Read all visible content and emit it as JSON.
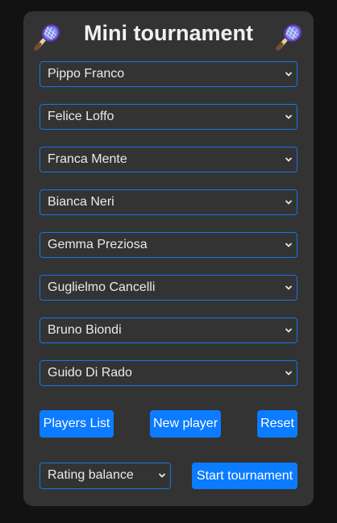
{
  "title": "Mini tournament",
  "icons": {
    "left": "tennis-racket-icon",
    "right": "tennis-racket-icon"
  },
  "players": [
    {
      "selected": "Pippo Franco"
    },
    {
      "selected": "Felice Loffo"
    },
    {
      "selected": "Franca Mente"
    },
    {
      "selected": "Bianca Neri"
    },
    {
      "selected": "Gemma Preziosa"
    },
    {
      "selected": "Guglielmo Cancelli"
    },
    {
      "selected": "Bruno Biondi"
    },
    {
      "selected": "Guido Di Rado"
    }
  ],
  "buttons": {
    "players_list": "Players List",
    "new_player": "New player",
    "reset": "Reset",
    "start_tournament": "Start tournament"
  },
  "mode": {
    "selected": "Rating balance"
  },
  "colors": {
    "background": "#121212",
    "card": "#333333",
    "accent": "#0b7bff",
    "select_border": "#1a73e8"
  }
}
